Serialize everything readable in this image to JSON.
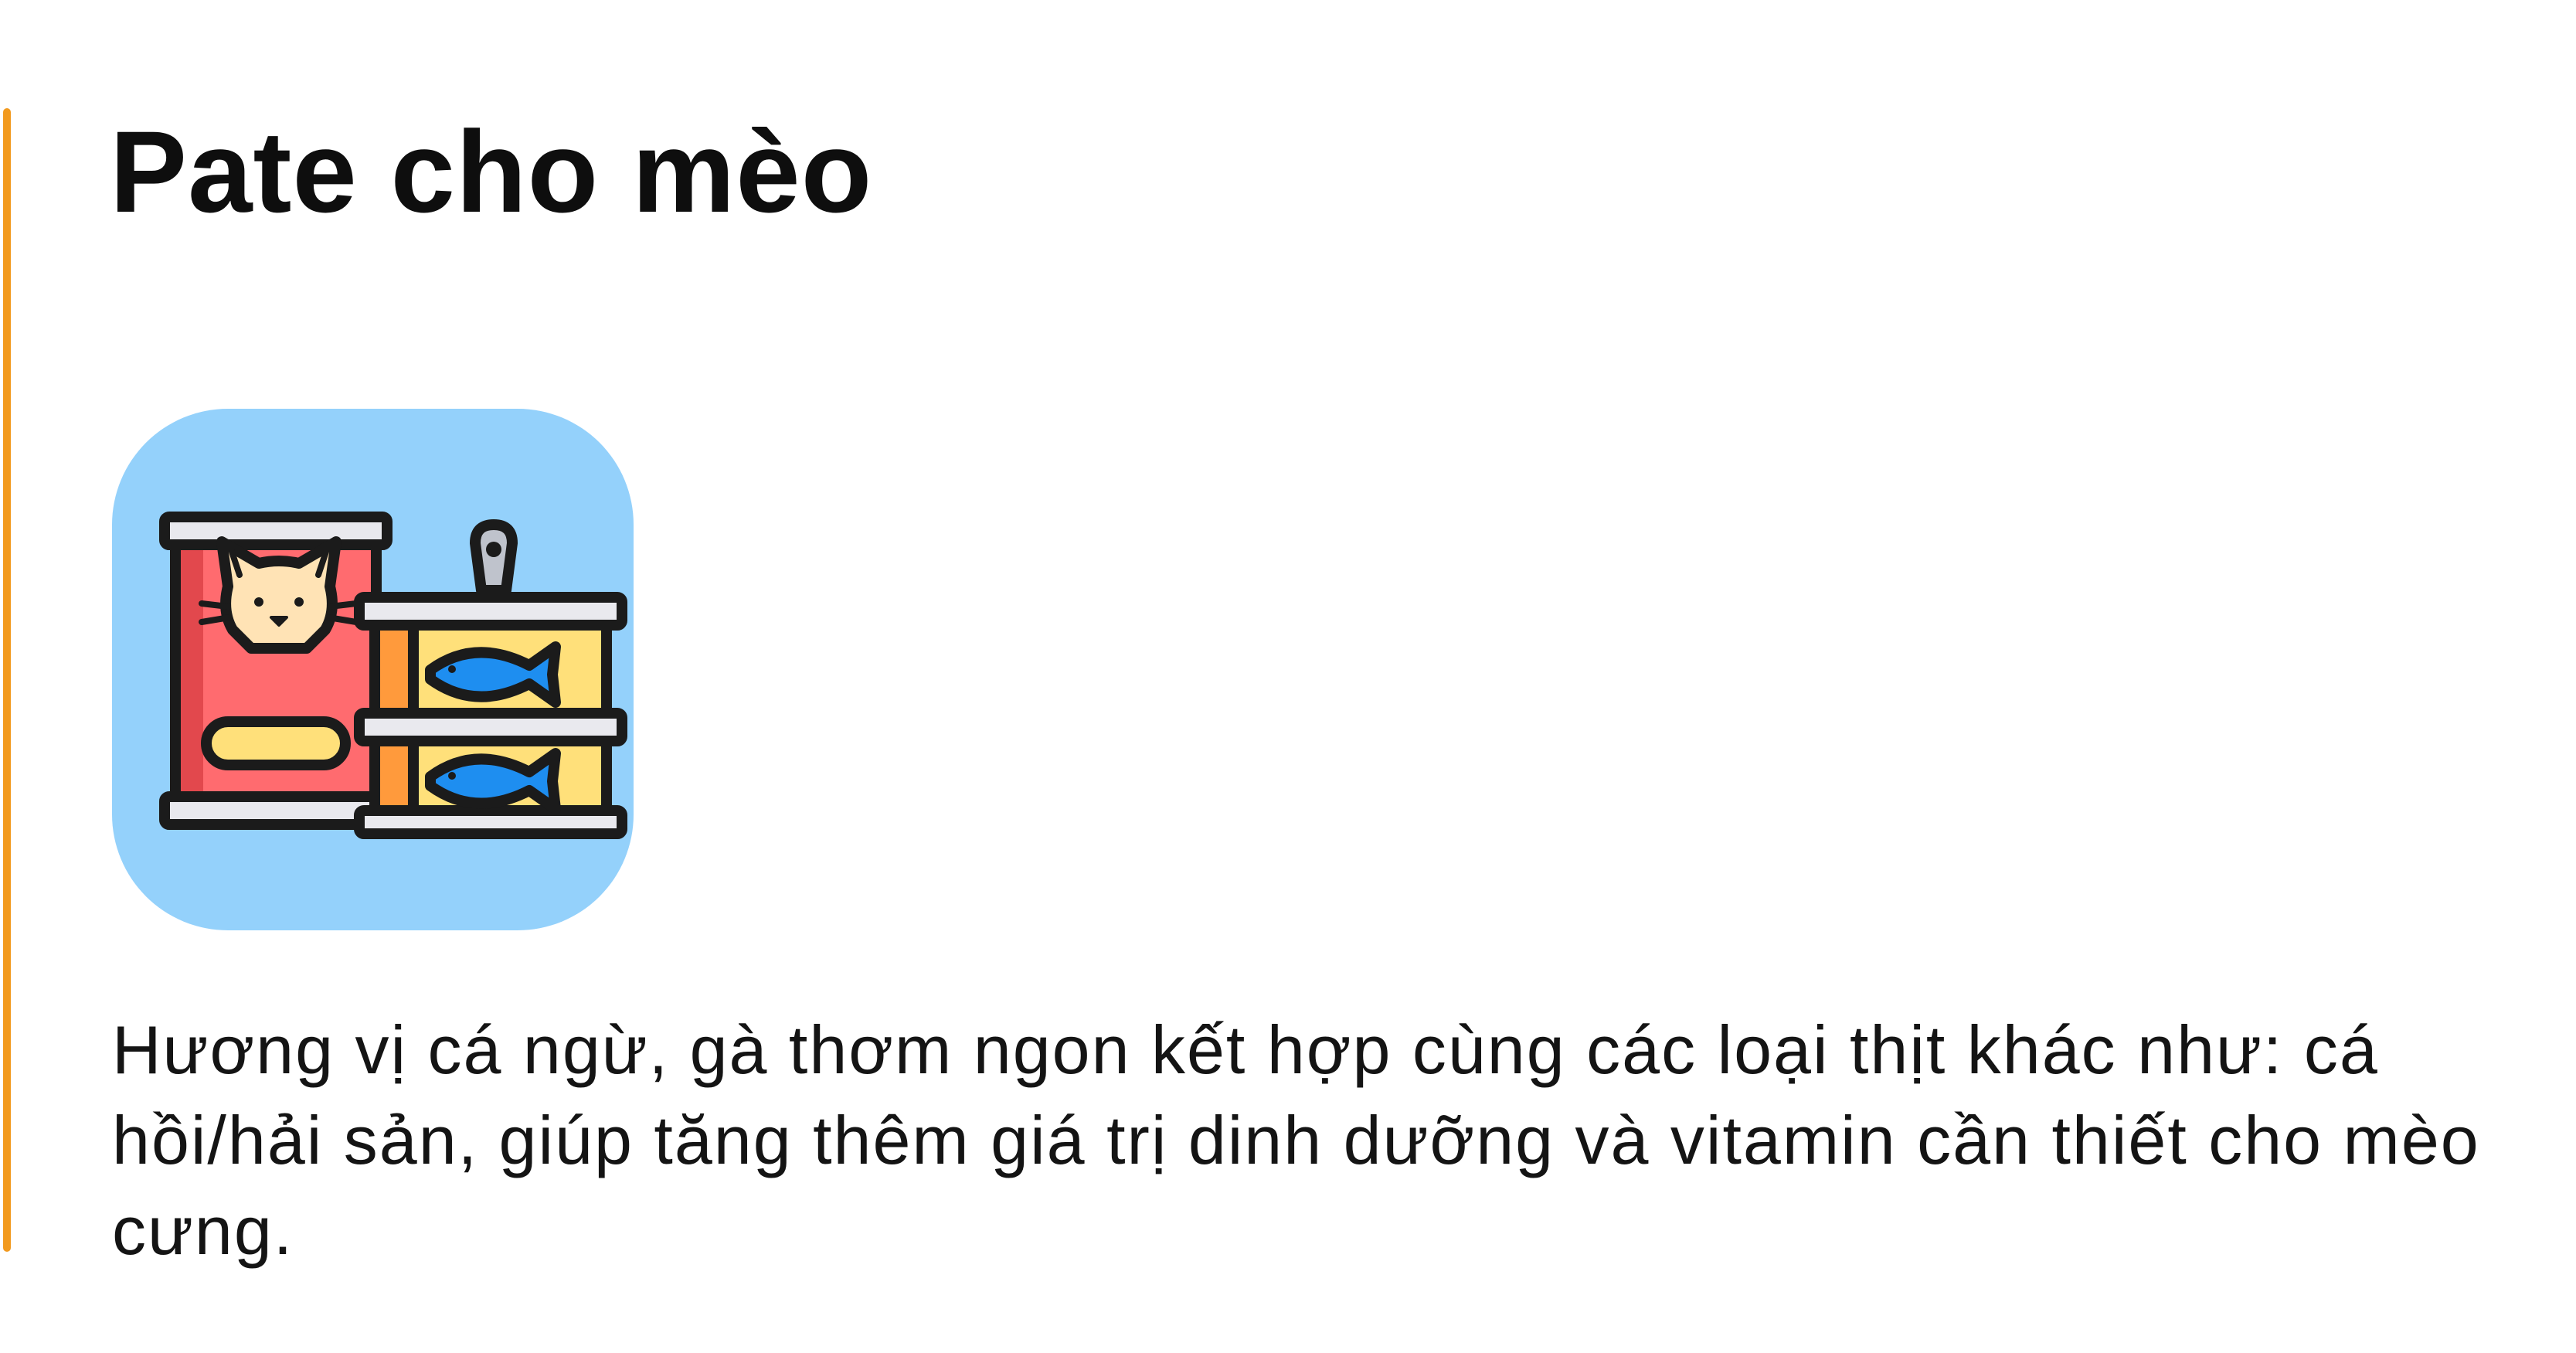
{
  "card": {
    "title": "Pate cho mèo",
    "icon": "cat-food-cans-icon",
    "description": "Hương vị cá ngừ, gà thơm ngon kết hợp cùng các loại thịt khác như: cá hồi/hải sản, giúp tăng thêm giá trị dinh dưỡng và vitamin cần thiết cho mèo cưng."
  },
  "colors": {
    "accent": "#f29a1f",
    "icon_background": "#94d1fb",
    "can_red": "#ff6b6f",
    "can_yellow": "#ffe07a",
    "can_orange": "#ff9a3c",
    "fish_blue": "#1e8ef0"
  }
}
